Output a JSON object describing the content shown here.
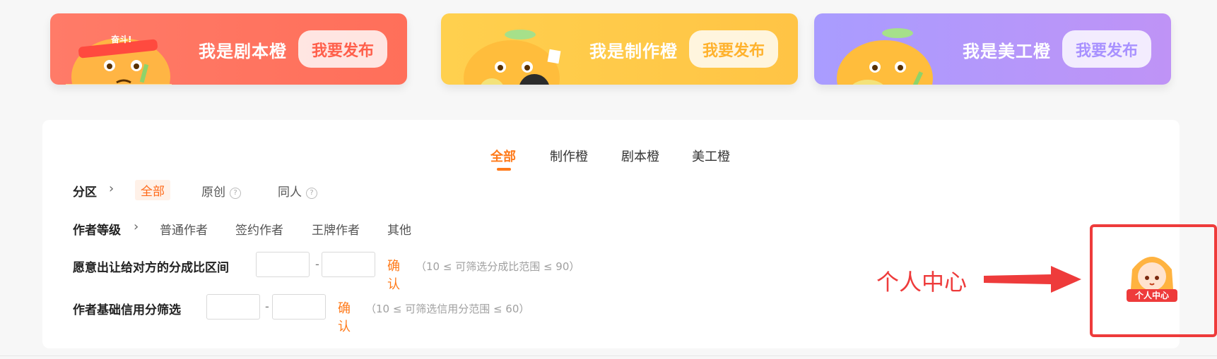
{
  "banners": [
    {
      "title": "我是剧本橙",
      "button": "我要发布",
      "badge": "奋斗!"
    },
    {
      "title": "我是制作橙",
      "button": "我要发布"
    },
    {
      "title": "我是美工橙",
      "button": "我要发布"
    }
  ],
  "tabs": [
    "全部",
    "制作橙",
    "剧本橙",
    "美工橙"
  ],
  "filters": {
    "section": {
      "label": "分区",
      "options": [
        "全部",
        "原创",
        "同人"
      ]
    },
    "author_level": {
      "label": "作者等级",
      "options": [
        "普通作者",
        "签约作者",
        "王牌作者",
        "其他"
      ]
    },
    "share_range": {
      "label": "愿意出让给对方的分成比区间",
      "confirm": "确认",
      "hint": "（10 ≤ 可筛选分成比范围 ≤ 90）",
      "dash": "-"
    },
    "credit_range": {
      "label": "作者基础信用分筛选",
      "confirm": "确认",
      "hint": "（10 ≤ 可筛选信用分范围 ≤ 60）",
      "dash": "-"
    }
  },
  "annotation": {
    "text": "个人中心"
  },
  "personal_center": {
    "label": "个人中心"
  },
  "colors": {
    "accent": "#ff7a1a",
    "annotation": "#ee3b3b"
  }
}
